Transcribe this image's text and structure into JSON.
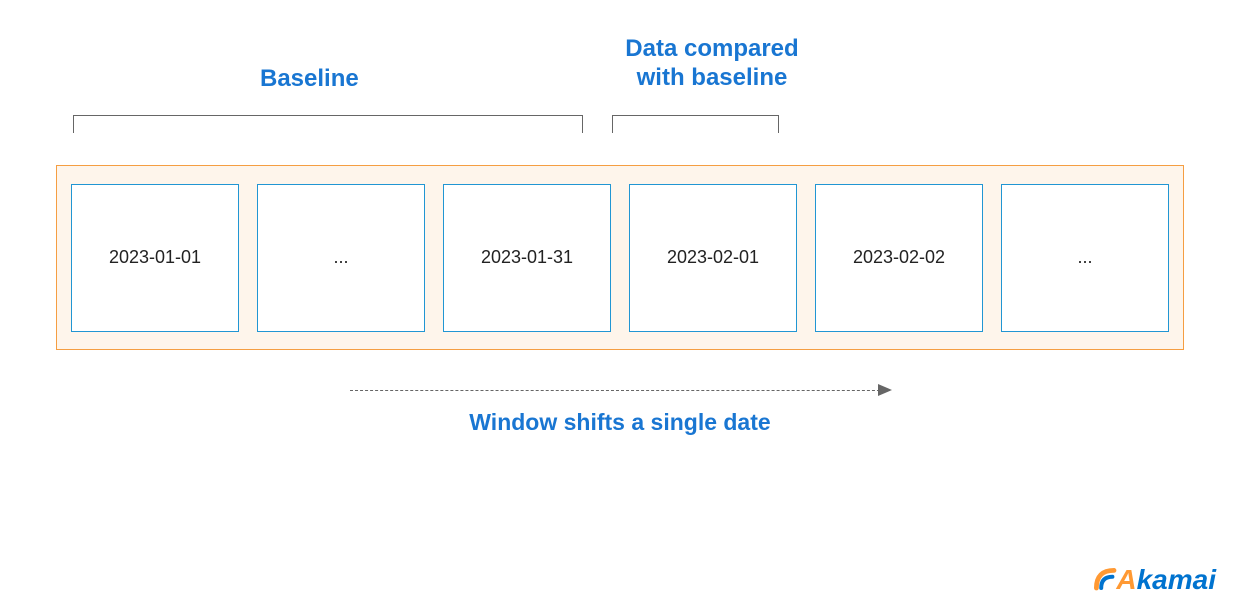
{
  "labels": {
    "baseline": "Baseline",
    "compared": "Data compared with baseline",
    "arrow": "Window shifts a single date"
  },
  "dates": {
    "d0": "2023-01-01",
    "d1": "...",
    "d2": "2023-01-31",
    "d3": "2023-02-01",
    "d4": "2023-02-02",
    "d5": "..."
  },
  "brand": {
    "name": "Akamai"
  }
}
